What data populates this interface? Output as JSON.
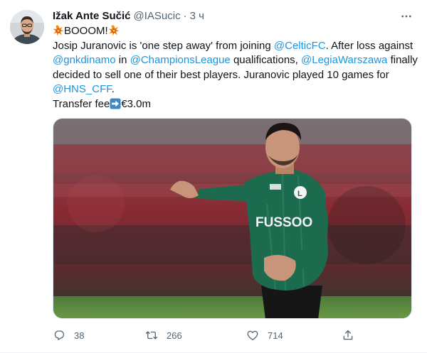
{
  "tweet": {
    "author_name": "Ižak Ante Sučić",
    "author_handle": "@IASucic",
    "separator": "·",
    "time": "3 ч",
    "text": {
      "line1_prefix": "",
      "line1_word": "BOOOM!",
      "line2_a": "Josip Juranovic is 'one step away' from joining ",
      "line2_mention": "@CelticFC",
      "line2_b": ". After loss against",
      "line3_mention1": "@gnkdinamo",
      "line3_a": " in ",
      "line3_mention2": "@ChampionsLeague",
      "line3_b": " qualifications, ",
      "line3_mention3": "@LegiaWarszawa",
      "line3_c": " finally",
      "line4": "decided to sell one of their best players. Juranovic played 10 games for",
      "line5_mention": "@HNS_CFF",
      "line5_b": ".",
      "line6_a": "Transfer fee",
      "line6_b": "€3.0m"
    },
    "media": {
      "shirt_sponsor": "FUSSOO"
    },
    "actions": {
      "replies": "38",
      "retweets": "266",
      "likes": "714"
    },
    "icons": {
      "more": "more-dots-icon",
      "reply": "reply-icon",
      "retweet": "retweet-icon",
      "like": "heart-icon",
      "share": "share-icon",
      "explosion": "collision-emoji",
      "arrow": "right-arrow-emoji"
    },
    "colors": {
      "link": "#1b95e0",
      "secondary_text": "#536471",
      "jersey_green": "#1d6b4f",
      "arrow_badge": "#3b88c3"
    }
  }
}
